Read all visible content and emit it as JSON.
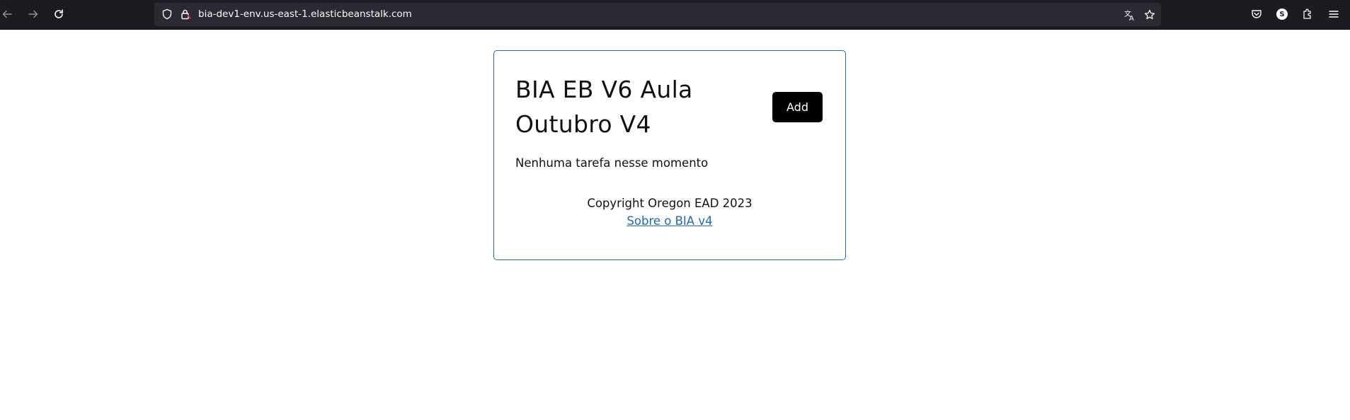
{
  "browser": {
    "url": "bia-dev1-env.us-east-1.elasticbeanstalk.com",
    "icons": {
      "back": "arrow-left-icon",
      "forward": "arrow-right-icon",
      "reload": "reload-icon",
      "shield": "shield-icon",
      "lock": "lock-warning-icon",
      "translate": "translate-icon",
      "bookmark": "star-icon",
      "pocket": "pocket-icon",
      "account": "account-icon",
      "extensions": "extensions-icon",
      "menu": "hamburger-menu-icon"
    },
    "account_initial": "S"
  },
  "page": {
    "title": "BIA EB V6 Aula Outubro V4",
    "add_label": "Add",
    "empty_message": "Nenhuma tarefa nesse momento",
    "copyright": "Copyright Oregon EAD 2023",
    "about_link": "Sobre o BIA v4"
  },
  "colors": {
    "toolbar_bg": "#1c1b22",
    "urlbar_bg": "#2b2a33",
    "card_border": "#1d6fb8",
    "link": "#1f67c7",
    "button_bg": "#000000"
  }
}
